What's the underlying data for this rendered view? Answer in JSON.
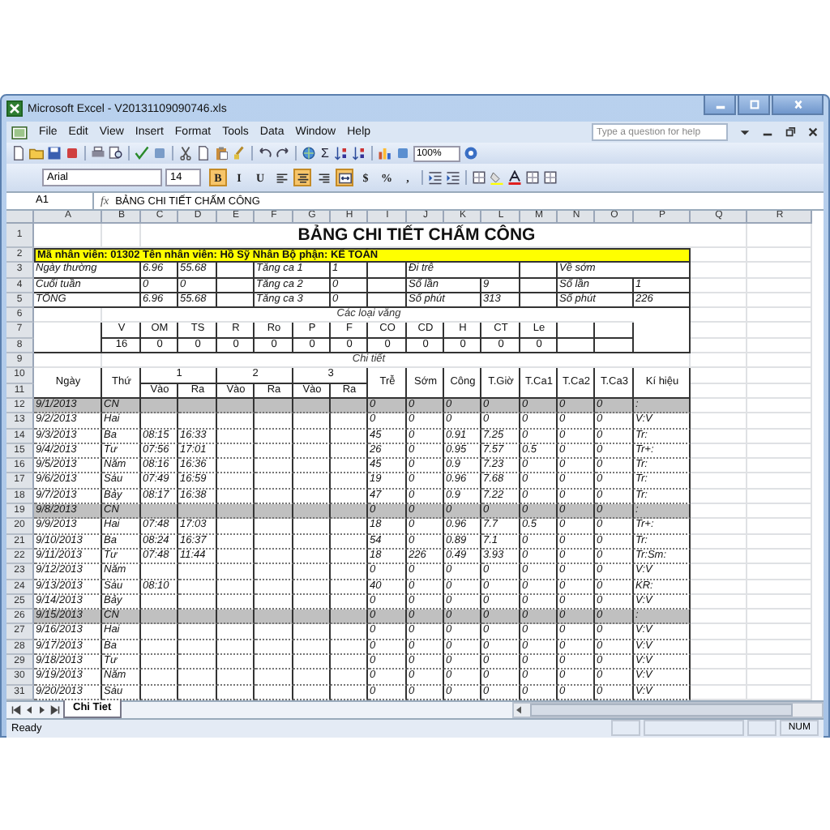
{
  "window": {
    "title": "Microsoft Excel - V20131109090746.xls"
  },
  "menu": [
    "File",
    "Edit",
    "View",
    "Insert",
    "Format",
    "Tools",
    "Data",
    "Window",
    "Help"
  ],
  "help_box": {
    "placeholder": "Type a question for help"
  },
  "toolbar": {
    "sum": "Σ",
    "zoom": "100%"
  },
  "format_bar": {
    "font": "Arial",
    "size": "14",
    "buttons": [
      {
        "kind": "text",
        "label": "B",
        "selected": true
      },
      {
        "kind": "text",
        "label": "I",
        "selected": false
      },
      {
        "kind": "text",
        "label": "U",
        "selected": false
      },
      {
        "kind": "align-left",
        "selected": false
      },
      {
        "kind": "align-center",
        "selected": true
      },
      {
        "kind": "align-right",
        "selected": false
      },
      {
        "kind": "merge",
        "selected": true
      },
      {
        "kind": "text",
        "label": "$",
        "selected": false
      },
      {
        "kind": "text",
        "label": "%",
        "selected": false
      },
      {
        "kind": "text",
        "label": ",",
        "selected": false
      }
    ]
  },
  "formula_bar": {
    "name_box": "A1",
    "fx": "fx",
    "value": "BẢNG CHI TIẾT CHẤM CÔNG"
  },
  "sheet": {
    "columns": [
      "A",
      "B",
      "C",
      "D",
      "E",
      "F",
      "G",
      "H",
      "I",
      "J",
      "K",
      "L",
      "M",
      "N",
      "O",
      "P",
      "Q",
      "R"
    ],
    "row_numbers": [
      "1",
      "2",
      "3",
      "4",
      "5",
      "6",
      "7",
      "8",
      "9",
      "10",
      "11",
      "12",
      "13",
      "14",
      "15",
      "16",
      "17",
      "18",
      "19",
      "20",
      "21",
      "22",
      "23",
      "24",
      "25",
      "26",
      "27",
      "28",
      "29",
      "30",
      "31"
    ],
    "title": "BẢNG CHI TIẾT CHẤM CÔNG",
    "info": "Mã nhân viên: 01302   Tên nhân viên: Hồ Sỹ Nhân   Bộ phận: KẾ TOÁN",
    "summary": [
      {
        "label": "Ngày thường",
        "c": "6.96",
        "d": "55.68",
        "ot_label": "Tăng ca 1",
        "ot": "1",
        "late_label": "Đi trễ",
        "early_label": "Về sớm"
      },
      {
        "label": "Cuối tuần",
        "c": "0",
        "d": "0",
        "ot_label": "Tăng ca 2",
        "ot": "0",
        "late_label": "Số lần",
        "late": "9",
        "early_label": "Số lần",
        "early": "1"
      },
      {
        "label": "TỔNG",
        "c": "6.96",
        "d": "55.68",
        "ot_label": "Tăng ca 3",
        "ot": "0",
        "late_label": "Số phút",
        "late": "313",
        "early_label": "Số phút",
        "early": "226"
      }
    ],
    "absence": {
      "caption": "Các loại vắng",
      "types": [
        {
          "code": "V",
          "count": "16"
        },
        {
          "code": "OM",
          "count": "0"
        },
        {
          "code": "TS",
          "count": "0"
        },
        {
          "code": "R",
          "count": "0"
        },
        {
          "code": "Ro",
          "count": "0"
        },
        {
          "code": "P",
          "count": "0"
        },
        {
          "code": "F",
          "count": "0"
        },
        {
          "code": "CO",
          "count": "0"
        },
        {
          "code": "CD",
          "count": "0"
        },
        {
          "code": "H",
          "count": "0"
        },
        {
          "code": "CT",
          "count": "0"
        },
        {
          "code": "Le",
          "count": "0"
        }
      ]
    },
    "detail": {
      "caption": "Chi tiết",
      "date_header": "Ngày",
      "day_header": "Thứ",
      "shifts": [
        {
          "label": "1",
          "in": "Vào",
          "out": "Ra"
        },
        {
          "label": "2",
          "in": "Vào",
          "out": "Ra"
        },
        {
          "label": "3",
          "in": "Vào",
          "out": "Ra"
        }
      ],
      "headers": [
        "Trễ",
        "Sớm",
        "Công",
        "T.Giờ",
        "T.Ca1",
        "T.Ca2",
        "T.Ca3",
        "Kí hiệu"
      ],
      "rows": [
        {
          "date": "9/1/2013",
          "day": "CN",
          "times": [],
          "values": [
            "0",
            "0",
            "0",
            "0",
            "0",
            "0",
            "0",
            ":"
          ],
          "shaded": true
        },
        {
          "date": "9/2/2013",
          "day": "Hai",
          "times": [],
          "values": [
            "0",
            "0",
            "0",
            "0",
            "0",
            "0",
            "0",
            "V:V"
          ],
          "shaded": false
        },
        {
          "date": "9/3/2013",
          "day": "Ba",
          "times": [
            "08:15",
            "16:33"
          ],
          "values": [
            "45",
            "0",
            "0.91",
            "7.25",
            "0",
            "0",
            "0",
            "Tr:"
          ],
          "shaded": false
        },
        {
          "date": "9/4/2013",
          "day": "Tư",
          "times": [
            "07:56",
            "17:01"
          ],
          "values": [
            "26",
            "0",
            "0.95",
            "7.57",
            "0.5",
            "0",
            "0",
            "Tr+:"
          ],
          "shaded": false
        },
        {
          "date": "9/5/2013",
          "day": "Năm",
          "times": [
            "08:16",
            "16:36"
          ],
          "values": [
            "45",
            "0",
            "0.9",
            "7.23",
            "0",
            "0",
            "0",
            "Tr:"
          ],
          "shaded": false
        },
        {
          "date": "9/6/2013",
          "day": "Sáu",
          "times": [
            "07:49",
            "16:59"
          ],
          "values": [
            "19",
            "0",
            "0.96",
            "7.68",
            "0",
            "0",
            "0",
            "Tr:"
          ],
          "shaded": false
        },
        {
          "date": "9/7/2013",
          "day": "Bảy",
          "times": [
            "08:17",
            "16:38"
          ],
          "values": [
            "47",
            "0",
            "0.9",
            "7.22",
            "0",
            "0",
            "0",
            "Tr:"
          ],
          "shaded": false
        },
        {
          "date": "9/8/2013",
          "day": "CN",
          "times": [],
          "values": [
            "0",
            "0",
            "0",
            "0",
            "0",
            "0",
            "0",
            ":"
          ],
          "shaded": true
        },
        {
          "date": "9/9/2013",
          "day": "Hai",
          "times": [
            "07:48",
            "17:03"
          ],
          "values": [
            "18",
            "0",
            "0.96",
            "7.7",
            "0.5",
            "0",
            "0",
            "Tr+:"
          ],
          "shaded": false
        },
        {
          "date": "9/10/2013",
          "day": "Ba",
          "times": [
            "08:24",
            "16:37"
          ],
          "values": [
            "54",
            "0",
            "0.89",
            "7.1",
            "0",
            "0",
            "0",
            "Tr:"
          ],
          "shaded": false
        },
        {
          "date": "9/11/2013",
          "day": "Tư",
          "times": [
            "07:48",
            "11:44"
          ],
          "values": [
            "18",
            "226",
            "0.49",
            "3.93",
            "0",
            "0",
            "0",
            "Tr:Sm:"
          ],
          "shaded": false
        },
        {
          "date": "9/12/2013",
          "day": "Năm",
          "times": [],
          "values": [
            "0",
            "0",
            "0",
            "0",
            "0",
            "0",
            "0",
            "V:V"
          ],
          "shaded": false
        },
        {
          "date": "9/13/2013",
          "day": "Sáu",
          "times": [
            "08:10"
          ],
          "values": [
            "40",
            "0",
            "0",
            "0",
            "0",
            "0",
            "0",
            "KR:"
          ],
          "shaded": false
        },
        {
          "date": "9/14/2013",
          "day": "Bảy",
          "times": [],
          "values": [
            "0",
            "0",
            "0",
            "0",
            "0",
            "0",
            "0",
            "V:V"
          ],
          "shaded": false
        },
        {
          "date": "9/15/2013",
          "day": "CN",
          "times": [],
          "values": [
            "0",
            "0",
            "0",
            "0",
            "0",
            "0",
            "0",
            ":"
          ],
          "shaded": true
        },
        {
          "date": "9/16/2013",
          "day": "Hai",
          "times": [],
          "values": [
            "0",
            "0",
            "0",
            "0",
            "0",
            "0",
            "0",
            "V:V"
          ],
          "shaded": false
        },
        {
          "date": "9/17/2013",
          "day": "Ba",
          "times": [],
          "values": [
            "0",
            "0",
            "0",
            "0",
            "0",
            "0",
            "0",
            "V:V"
          ],
          "shaded": false
        },
        {
          "date": "9/18/2013",
          "day": "Tư",
          "times": [],
          "values": [
            "0",
            "0",
            "0",
            "0",
            "0",
            "0",
            "0",
            "V:V"
          ],
          "shaded": false
        },
        {
          "date": "9/19/2013",
          "day": "Năm",
          "times": [],
          "values": [
            "0",
            "0",
            "0",
            "0",
            "0",
            "0",
            "0",
            "V:V"
          ],
          "shaded": false
        },
        {
          "date": "9/20/2013",
          "day": "Sáu",
          "times": [],
          "values": [
            "0",
            "0",
            "0",
            "0",
            "0",
            "0",
            "0",
            "V:V"
          ],
          "shaded": false
        }
      ]
    }
  },
  "sheet_tabs": [
    {
      "label": "Chi Tiet",
      "selected": true
    }
  ],
  "status_bar": {
    "text": "Ready",
    "indicators": [
      "NUM"
    ]
  }
}
